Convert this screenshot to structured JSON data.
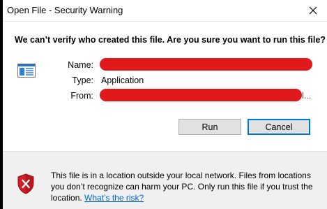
{
  "window": {
    "title": "Open File - Security Warning",
    "close_symbol": "✕"
  },
  "dialog": {
    "headline": "We can’t verify who created this file. Are you sure you want to run this file?",
    "icon": "application-window-icon",
    "fields": {
      "name_label": "Name:",
      "name_value": "",
      "type_label": "Type:",
      "type_value": "Application",
      "from_label": "From:",
      "from_value_start": "\\",
      "from_value_end": "l..."
    },
    "buttons": {
      "run": "Run",
      "cancel": "Cancel"
    }
  },
  "warning": {
    "icon": "shield-error-icon",
    "text": "This file is in a location outside your local network. Files from locations you don’t recognize can harm your PC. Only run this file if you trust the location. ",
    "link_text": "What’s the risk?"
  },
  "colors": {
    "accent": "#0078d7",
    "link": "#0066cc",
    "redaction": "#e01a1a",
    "shield": "#d01f26"
  }
}
